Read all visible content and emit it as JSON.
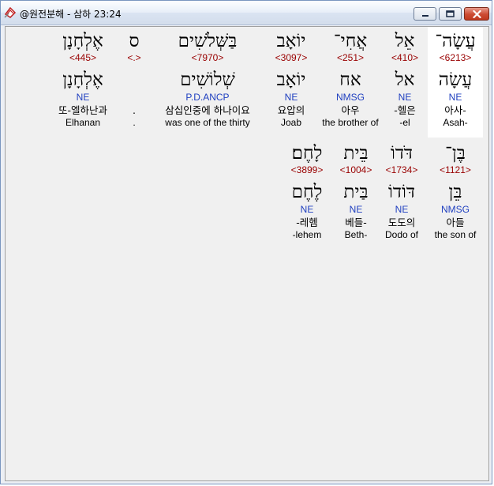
{
  "window": {
    "title": "@원전분해 - 삼하 23:24",
    "icons": {
      "app": "app-icon",
      "minimize": "minimize-icon",
      "maximize": "maximize-icon",
      "close": "close-icon"
    }
  },
  "verse": {
    "row1": [
      {
        "heb": "עֲשָׂה־",
        "strong": "<6213>",
        "lemma": "עֲשָׂה",
        "morph": "NE",
        "korean": "아사-",
        "english": "Asah-"
      },
      {
        "heb": "אֵל",
        "strong": "<410>",
        "lemma": "אל",
        "morph": "NE",
        "korean": "-헬은",
        "english": "-el"
      },
      {
        "heb": "אֲחִי־",
        "strong": "<251>",
        "lemma": "אח",
        "morph": "NMSG",
        "korean": "아우",
        "english": "the brother of"
      },
      {
        "heb": "יוֹאָב",
        "strong": "<3097>",
        "lemma": "יוֹאָב",
        "morph": "NE",
        "korean": "요압의",
        "english": "Joab"
      },
      {
        "heb": "בַּשְּׁלֹשִׁים",
        "strong": "<7970>",
        "lemma": "שְׁלוֹשִׁים",
        "morph": "P.D.ANCP",
        "korean": "삼십인중에 하나이요",
        "english": "was one of the thirty"
      },
      {
        "heb": "ס",
        "strong": "<.>",
        "lemma": "",
        "morph": "",
        "korean": ".",
        "english": "."
      },
      {
        "heb": "אֶלְחָנָן",
        "strong": "<445>",
        "lemma": "אֶלְחָנָן",
        "morph": "NE",
        "korean": "또-엘하난과",
        "english": "Elhanan"
      }
    ],
    "row2": [
      {
        "heb": "בֶּן־",
        "strong": "<1121>",
        "lemma": "בֵּן",
        "morph": "NMSG",
        "korean": "아들",
        "english": "the son of"
      },
      {
        "heb": "דֹּדוֹ",
        "strong": "<1734>",
        "lemma": "דּוֹדוֹ",
        "morph": "NE",
        "korean": "도도의",
        "english": "Dodo of"
      },
      {
        "heb": "בֵּית",
        "strong": "<1004>",
        "lemma": "בַּית",
        "morph": "NE",
        "korean": "베들-",
        "english": "Beth-"
      },
      {
        "heb": "לָחֶם׃",
        "strong": "<3899>",
        "lemma": "לֶחֶם",
        "morph": "NE",
        "korean": "-레헴",
        "english": "-lehem"
      }
    ]
  }
}
